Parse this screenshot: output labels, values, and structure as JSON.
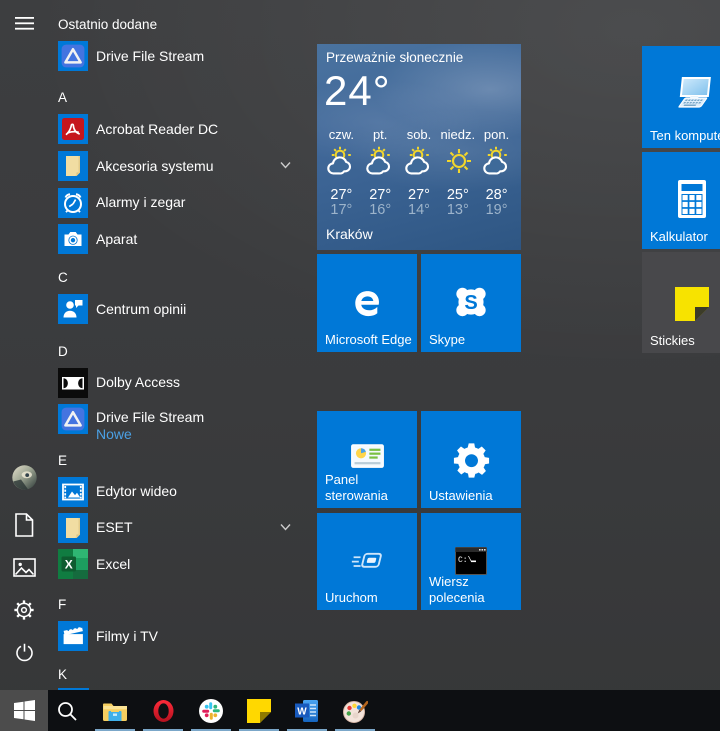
{
  "accent_color": "#0078d7",
  "start_menu": {
    "rail": {
      "items": [
        {
          "id": "menu",
          "icon": "hamburger-icon"
        },
        {
          "id": "user",
          "icon": "user-avatar"
        },
        {
          "id": "documents",
          "icon": "document-icon"
        },
        {
          "id": "pictures",
          "icon": "pictures-icon"
        },
        {
          "id": "settings",
          "icon": "gear-icon"
        },
        {
          "id": "power",
          "icon": "power-icon"
        }
      ]
    },
    "app_list": {
      "rows": [
        {
          "type": "section",
          "label": "Ostatnio dodane"
        },
        {
          "type": "app",
          "label": "Drive File Stream",
          "icon": "google-drive-icon"
        },
        {
          "type": "letter",
          "label": "A"
        },
        {
          "type": "app",
          "label": "Acrobat Reader DC",
          "icon": "acrobat-reader-icon"
        },
        {
          "type": "app",
          "label": "Akcesoria systemu",
          "icon": "folder-icon",
          "chevron": true
        },
        {
          "type": "app",
          "label": "Alarmy i zegar",
          "icon": "alarm-clock-icon"
        },
        {
          "type": "app",
          "label": "Aparat",
          "icon": "camera-icon"
        },
        {
          "type": "letter",
          "label": "C"
        },
        {
          "type": "app",
          "label": "Centrum opinii",
          "icon": "feedback-hub-icon"
        },
        {
          "type": "letter",
          "label": "D"
        },
        {
          "type": "app",
          "label": "Dolby Access",
          "icon": "dolby-icon"
        },
        {
          "type": "app",
          "label": "Drive File Stream",
          "sub": "Nowe",
          "icon": "google-drive-icon"
        },
        {
          "type": "letter",
          "label": "E"
        },
        {
          "type": "app",
          "label": "Edytor wideo",
          "icon": "video-editor-icon"
        },
        {
          "type": "app",
          "label": "ESET",
          "icon": "folder-icon",
          "chevron": true
        },
        {
          "type": "app",
          "label": "Excel",
          "icon": "excel-icon"
        },
        {
          "type": "letter",
          "label": "F"
        },
        {
          "type": "app",
          "label": "Filmy i TV",
          "icon": "movies-tv-icon"
        },
        {
          "type": "letter",
          "label": "K"
        },
        {
          "type": "partial",
          "label": "",
          "icon": "partial-tile"
        }
      ]
    },
    "tiles": {
      "weather": {
        "title": "Przeważnie słonecznie",
        "temperature": "24°",
        "city": "Kraków",
        "days": [
          {
            "name": "czw.",
            "icon": "partly-cloudy-icon",
            "high": "27°",
            "low": "17°"
          },
          {
            "name": "pt.",
            "icon": "partly-cloudy-icon",
            "high": "27°",
            "low": "16°"
          },
          {
            "name": "sob.",
            "icon": "partly-cloudy-icon",
            "high": "27°",
            "low": "14°"
          },
          {
            "name": "niedz.",
            "icon": "sunny-icon",
            "high": "25°",
            "low": "13°"
          },
          {
            "name": "pon.",
            "icon": "partly-cloudy-icon",
            "high": "28°",
            "low": "19°"
          }
        ]
      },
      "edge": {
        "label": "Microsoft Edge",
        "icon": "edge-logo"
      },
      "skype": {
        "label": "Skype",
        "icon": "skype-logo"
      },
      "ten_komputer": {
        "label": "Ten komputer",
        "icon": "computer-icon"
      },
      "kalkulator": {
        "label": "Kalkulator",
        "icon": "calculator-icon"
      },
      "stickies": {
        "label": "Stickies",
        "icon": "sticky-note-icon"
      },
      "panel_sterowania": {
        "label": "Panel sterowania",
        "icon": "control-panel-icon"
      },
      "ustawienia": {
        "label": "Ustawienia",
        "icon": "settings-gear-icon"
      },
      "uruchom": {
        "label": "Uruchom",
        "icon": "run-icon"
      },
      "wiersz_polecenia": {
        "label": "Wiersz polecenia",
        "icon": "command-prompt-icon"
      }
    }
  },
  "taskbar": {
    "items": [
      {
        "id": "start",
        "icon": "windows-start-icon",
        "active": true,
        "underline": false
      },
      {
        "id": "search",
        "icon": "search-icon",
        "active": false,
        "underline": false
      },
      {
        "id": "file-explorer",
        "icon": "file-explorer-icon",
        "active": false,
        "underline": true
      },
      {
        "id": "opera",
        "icon": "opera-icon",
        "active": false,
        "underline": true
      },
      {
        "id": "slack",
        "icon": "slack-icon",
        "active": false,
        "underline": true
      },
      {
        "id": "sticky-notes",
        "icon": "sticky-notes-icon",
        "active": false,
        "underline": true
      },
      {
        "id": "word",
        "icon": "word-icon",
        "active": false,
        "underline": true
      },
      {
        "id": "paint",
        "icon": "paint-icon",
        "active": false,
        "underline": true
      }
    ]
  }
}
